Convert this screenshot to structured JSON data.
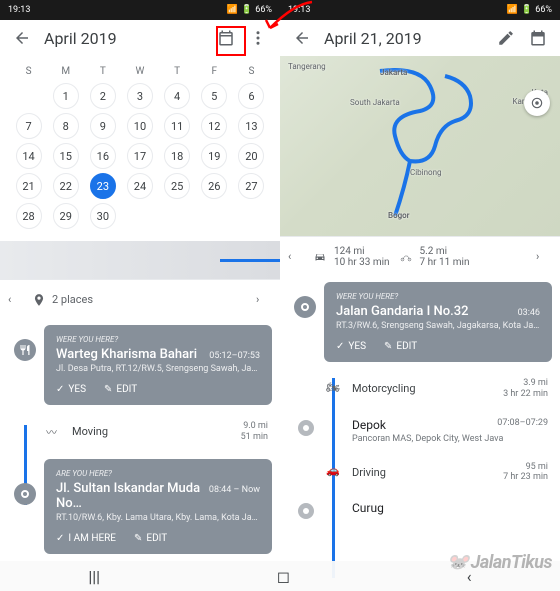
{
  "status": {
    "time": "19:13",
    "battery": "66%"
  },
  "left": {
    "title": "April 2019",
    "weekdays": [
      "S",
      "M",
      "T",
      "W",
      "T",
      "F",
      "S"
    ],
    "days": [
      "",
      "1",
      "2",
      "3",
      "4",
      "5",
      "6",
      "7",
      "8",
      "9",
      "10",
      "11",
      "12",
      "13",
      "14",
      "15",
      "16",
      "17",
      "18",
      "19",
      "20",
      "21",
      "22",
      "23",
      "24",
      "25",
      "26",
      "27",
      "28",
      "29",
      "30",
      "",
      "",
      "",
      ""
    ],
    "selected": "23",
    "summary_places": "2 places",
    "card1": {
      "tag": "WERE YOU HERE?",
      "name": "Warteg Kharisma Bahari",
      "time": "05:12–07:53",
      "addr": "Jl. Desa Putra, RT.12/RW.5, Srengseng Sawah, Jag…",
      "yes": "YES",
      "edit": "EDIT"
    },
    "seg1": {
      "label": "Moving",
      "dist": "9.0 mi",
      "dur": "51 min"
    },
    "card2": {
      "tag": "ARE YOU HERE?",
      "name": "Jl. Sultan Iskandar Muda No…",
      "time": "08:44 – Now",
      "addr": "RT.10/RW.6, Kby. Lama Utara, Kby. Lama, Kota Jak…",
      "here": "I AM HERE",
      "edit": "EDIT"
    }
  },
  "right": {
    "title": "April 21, 2019",
    "map_labels": {
      "tangerang": "Tangerang",
      "jakarta": "Jakarta",
      "sjakarta": "South Jakarta",
      "cibinong": "Cibinong",
      "bogor": "Bogor",
      "karawang": "Kota\nKarawang"
    },
    "sum1": {
      "dist": "124 mi",
      "dur": "10 hr 33 min"
    },
    "sum2": {
      "dist": "5.2 mi",
      "dur": "7 hr 11 min"
    },
    "card1": {
      "tag": "WERE YOU HERE?",
      "name": "Jalan Gandaria I No.32",
      "time": "03:46",
      "addr": "RT.3/RW.6, Srengseng Sawah, Jagakarsa, Kota Ja…",
      "yes": "YES",
      "edit": "EDIT"
    },
    "seg_moto": {
      "label": "Motorcycling",
      "dist": "3.9 mi",
      "dur": "3 hr 22 min"
    },
    "stop_depok": {
      "name": "Depok",
      "time": "07:08–07:29",
      "addr": "Pancoran MAS, Depok City, West Java"
    },
    "seg_drive": {
      "label": "Driving",
      "dist": "95 mi",
      "dur": "7 hr 23 min"
    },
    "stop_curug": {
      "name": "Curug",
      "time": ""
    }
  },
  "watermark": "JalanTikus"
}
